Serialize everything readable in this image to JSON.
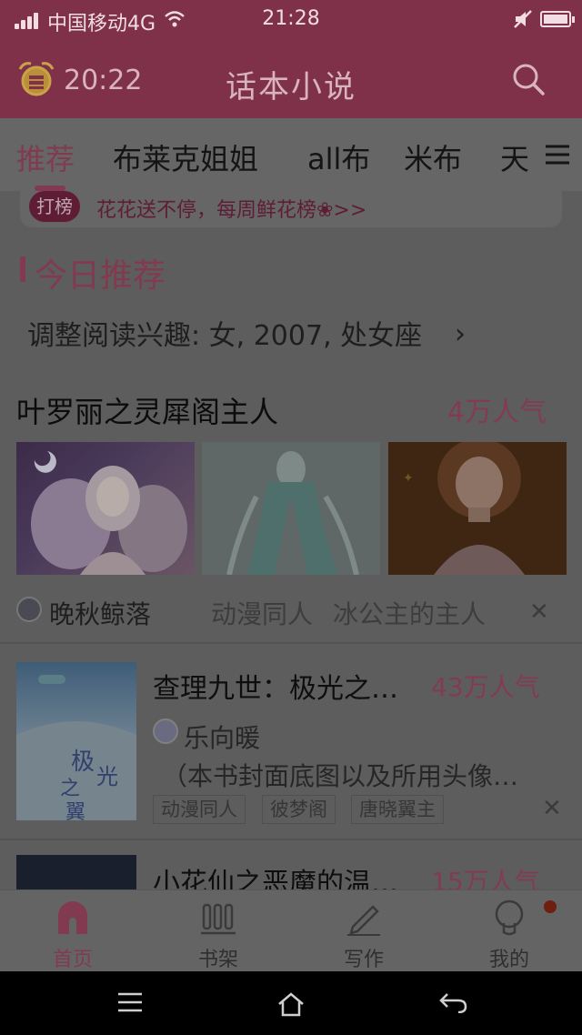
{
  "status_bar": {
    "carrier": "中国移动4G",
    "time": "21:28"
  },
  "header": {
    "alarm_time": "20:22",
    "title": "话本小说"
  },
  "tabs": {
    "items": [
      {
        "label": "推荐",
        "active": true
      },
      {
        "label": "布莱克姐姐"
      },
      {
        "label": "all布"
      },
      {
        "label": "米布"
      },
      {
        "label": "天"
      }
    ]
  },
  "notice": {
    "tag": "打榜",
    "text": "花花送不停，每周鲜花榜❀>>"
  },
  "section": {
    "title": "今日推荐",
    "interest_line": "调整阅读兴趣: 女, 2007, 处女座"
  },
  "featured": {
    "title": "叶罗丽之灵犀阁主人",
    "popularity": "4万人气",
    "author": "晚秋鲸落",
    "tags": [
      "动漫同人",
      "冰公主的主人"
    ]
  },
  "books": [
    {
      "title": "查理九世：极光之…",
      "popularity": "43万人气",
      "author": "乐向暖",
      "description": "（本书封面底图以及所用头像…",
      "tags": [
        "动漫同人",
        "彼梦阁",
        "唐晓翼主"
      ]
    },
    {
      "title": "小花仙之恶魔的温…",
      "popularity": "15万人气"
    }
  ],
  "bottom_nav": [
    {
      "label": "首页",
      "icon": "home-icon",
      "active": true
    },
    {
      "label": "书架",
      "icon": "bookshelf-icon"
    },
    {
      "label": "写作",
      "icon": "pencil-icon"
    },
    {
      "label": "我的",
      "icon": "profile-icon"
    }
  ],
  "colors": {
    "brand": "#813a4f",
    "header_bg": "#7e3148",
    "overlay_bg": "#5d5d5d"
  }
}
